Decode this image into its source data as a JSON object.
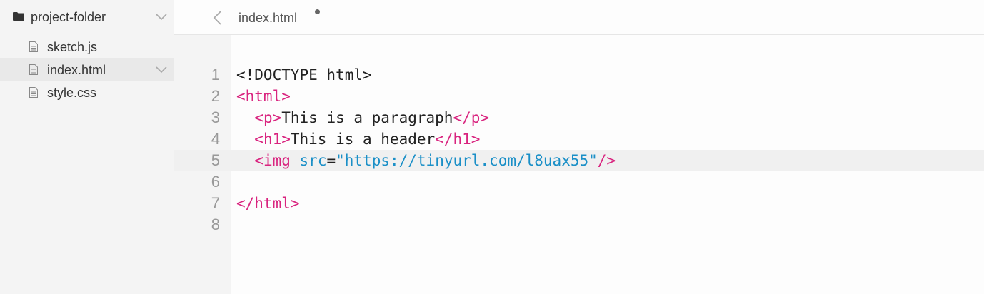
{
  "sidebar": {
    "folder": {
      "name": "project-folder",
      "icon": "folder-icon"
    },
    "files": [
      {
        "name": "sketch.js",
        "icon": "file-icon",
        "selected": false
      },
      {
        "name": "index.html",
        "icon": "file-icon",
        "selected": true
      },
      {
        "name": "style.css",
        "icon": "file-icon",
        "selected": false
      }
    ]
  },
  "editor": {
    "tab_title": "index.html",
    "unsaved": true,
    "active_line": 5,
    "colors": {
      "tag": "#d9247f",
      "attr": "#1a8fc7",
      "string": "#1a8fc7",
      "text": "#222222",
      "line_number": "#999999"
    },
    "lines": [
      {
        "num": "1",
        "tokens": [
          {
            "t": "plain",
            "v": "<!DOCTYPE html>"
          }
        ]
      },
      {
        "num": "2",
        "tokens": [
          {
            "t": "tag",
            "v": "<html>"
          }
        ]
      },
      {
        "num": "3",
        "tokens": [
          {
            "t": "plain",
            "v": "  "
          },
          {
            "t": "tag",
            "v": "<p>"
          },
          {
            "t": "plain",
            "v": "This is a paragraph"
          },
          {
            "t": "tag",
            "v": "</p>"
          }
        ]
      },
      {
        "num": "4",
        "tokens": [
          {
            "t": "plain",
            "v": "  "
          },
          {
            "t": "tag",
            "v": "<h1>"
          },
          {
            "t": "plain",
            "v": "This is a header"
          },
          {
            "t": "tag",
            "v": "</h1>"
          }
        ]
      },
      {
        "num": "5",
        "tokens": [
          {
            "t": "plain",
            "v": "  "
          },
          {
            "t": "tag",
            "v": "<img"
          },
          {
            "t": "plain",
            "v": " "
          },
          {
            "t": "attr",
            "v": "src"
          },
          {
            "t": "plain",
            "v": "="
          },
          {
            "t": "str",
            "v": "\"https://tinyurl.com/l8uax55\""
          },
          {
            "t": "tag",
            "v": "/>"
          }
        ]
      },
      {
        "num": "6",
        "tokens": []
      },
      {
        "num": "7",
        "tokens": [
          {
            "t": "tag",
            "v": "</html>"
          }
        ]
      },
      {
        "num": "8",
        "tokens": []
      }
    ]
  }
}
